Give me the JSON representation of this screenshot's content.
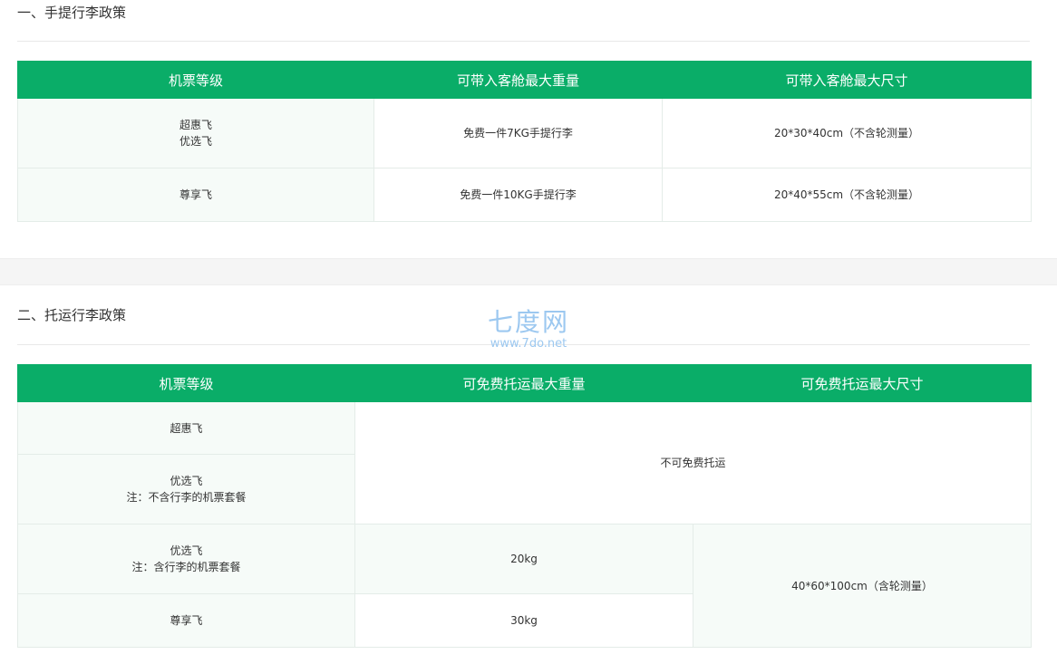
{
  "carry_on": {
    "title": "一、手提行李政策",
    "headers": [
      "机票等级",
      "可带入客舱最大重量",
      "可带入客舱最大尺寸"
    ],
    "rows": [
      {
        "grade_lines": [
          "超惠飞",
          "优选飞"
        ],
        "weight": "免费一件7KG手提行李",
        "size": "20*30*40cm（不含轮测量）"
      },
      {
        "grade_lines": [
          "尊享飞"
        ],
        "weight": "免费一件10KG手提行李",
        "size": "20*40*55cm（不含轮测量）"
      }
    ]
  },
  "checked": {
    "title": "二、托运行李政策",
    "headers": [
      "机票等级",
      "可免费托运最大重量",
      "可免费托运最大尺寸"
    ],
    "rows": [
      {
        "grade_lines": [
          "超惠飞"
        ]
      },
      {
        "grade_lines": [
          "优选飞",
          "注：不含行李的机票套餐"
        ]
      },
      {
        "grade_lines": [
          "优选飞",
          "注：含行李的机票套餐"
        ],
        "weight": "20kg"
      },
      {
        "grade_lines": [
          "尊享飞"
        ],
        "weight": "30kg"
      }
    ],
    "no_free_text": "不可免费托运",
    "shared_size": "40*60*100cm（含轮测量）"
  },
  "watermark": {
    "main": "七度网",
    "sub": "www.7do.net"
  },
  "colors": {
    "header_green": "#0aad68",
    "row_tint": "#f6fbf8",
    "watermark": "#9cc8f0"
  }
}
